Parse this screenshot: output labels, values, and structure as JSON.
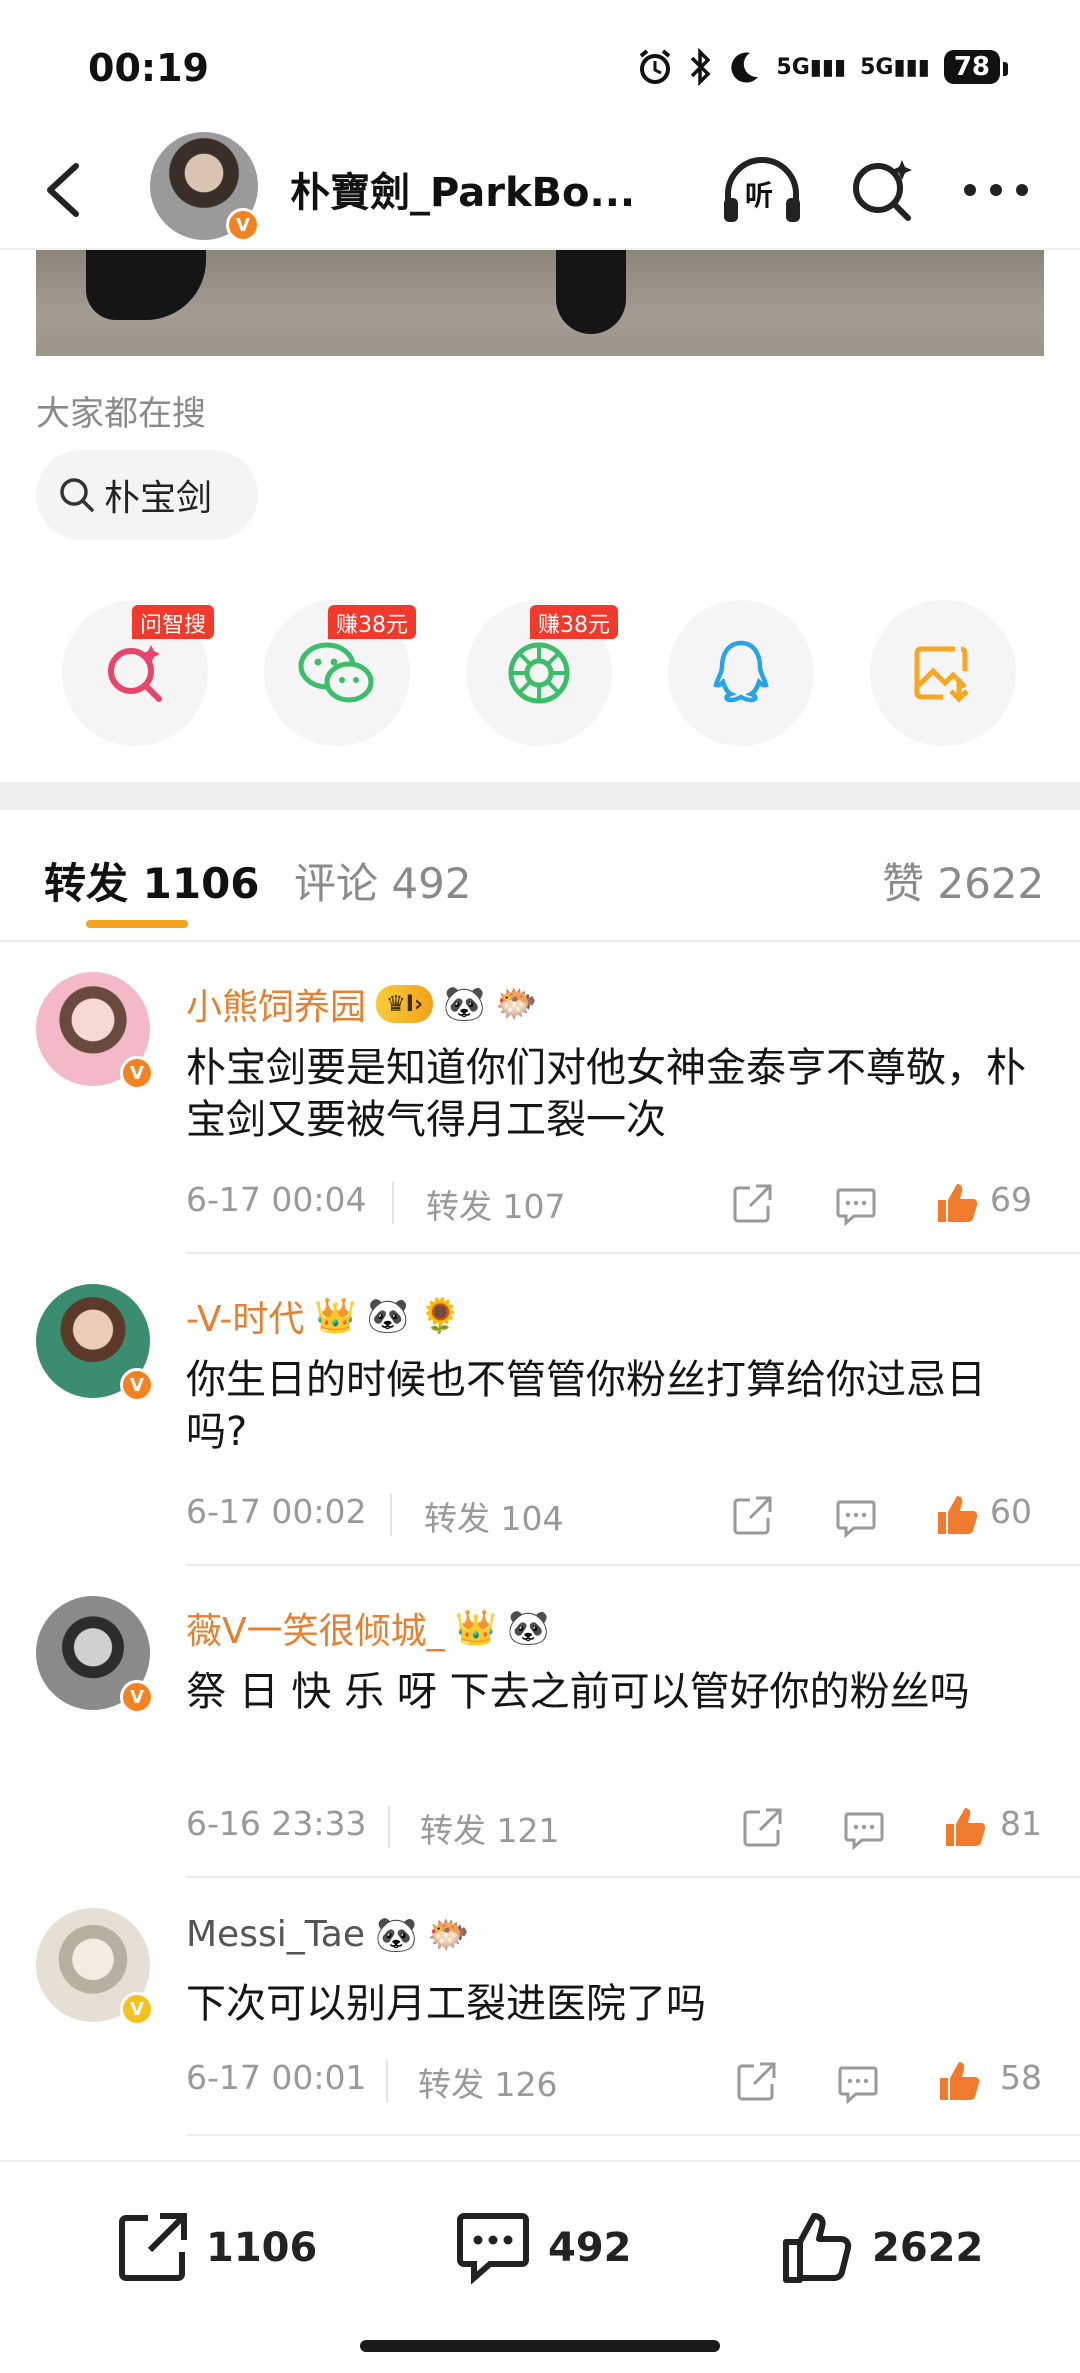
{
  "status_bar": {
    "time": "00:19",
    "battery": "78",
    "signal_1": "5G",
    "signal_2": "5G"
  },
  "header": {
    "title": "朴寶劍_ParkBo...",
    "listen_label": "听",
    "icons": [
      "back-icon",
      "avatar",
      "listen-icon",
      "ai-search-icon",
      "more-icon"
    ]
  },
  "search_section": {
    "label": "大家都在搜",
    "chip": "朴宝剑"
  },
  "share_row": {
    "items": [
      {
        "name": "ai-search",
        "tag": "问智搜",
        "color": "#e8456b"
      },
      {
        "name": "wechat",
        "tag": "赚38元",
        "color": "#3bbd6a"
      },
      {
        "name": "moments",
        "tag": "赚38元",
        "color": "#3bbd6a"
      },
      {
        "name": "qq",
        "tag": "",
        "color": "#27a3e8"
      },
      {
        "name": "save-image",
        "tag": "",
        "color": "#f5a623"
      }
    ]
  },
  "tabs": {
    "repost": "转发 1106",
    "comments": "评论 492",
    "likes": "赞 2622"
  },
  "comments": [
    {
      "username": "小熊饲养园",
      "badge": "I",
      "text": "朴宝剑要是知道你们对他女神金泰亨不尊敬，朴宝剑又要被气得月工裂一次",
      "time": "6-17 00:04",
      "reposts": "转发 107",
      "likes": "69",
      "name_color": "#e4802f"
    },
    {
      "username": "-V-时代",
      "badge": "",
      "text": "你生日的时候也不管管你粉丝打算给你过忌日吗?",
      "time": "6-17 00:02",
      "reposts": "转发 104",
      "likes": "60",
      "name_color": "#e4802f"
    },
    {
      "username": "薇V一笑很倾城_",
      "badge": "",
      "text": "祭 日 快 乐 呀 下去之前可以管好你的粉丝吗",
      "time": "6-16 23:33",
      "reposts": "转发 121",
      "likes": "81",
      "name_color": "#e4802f"
    },
    {
      "username": "Messi_Tae",
      "badge": "",
      "text": "下次可以别月工裂进医院了吗",
      "time": "6-17 00:01",
      "reposts": "转发 126",
      "likes": "58",
      "name_color": "#555555"
    }
  ],
  "bottom_bar": {
    "reposts": "1106",
    "comments": "492",
    "likes": "2622"
  },
  "colors": {
    "accent": "#f4a31f",
    "like": "#f07b2c",
    "verify": "#f58220"
  }
}
